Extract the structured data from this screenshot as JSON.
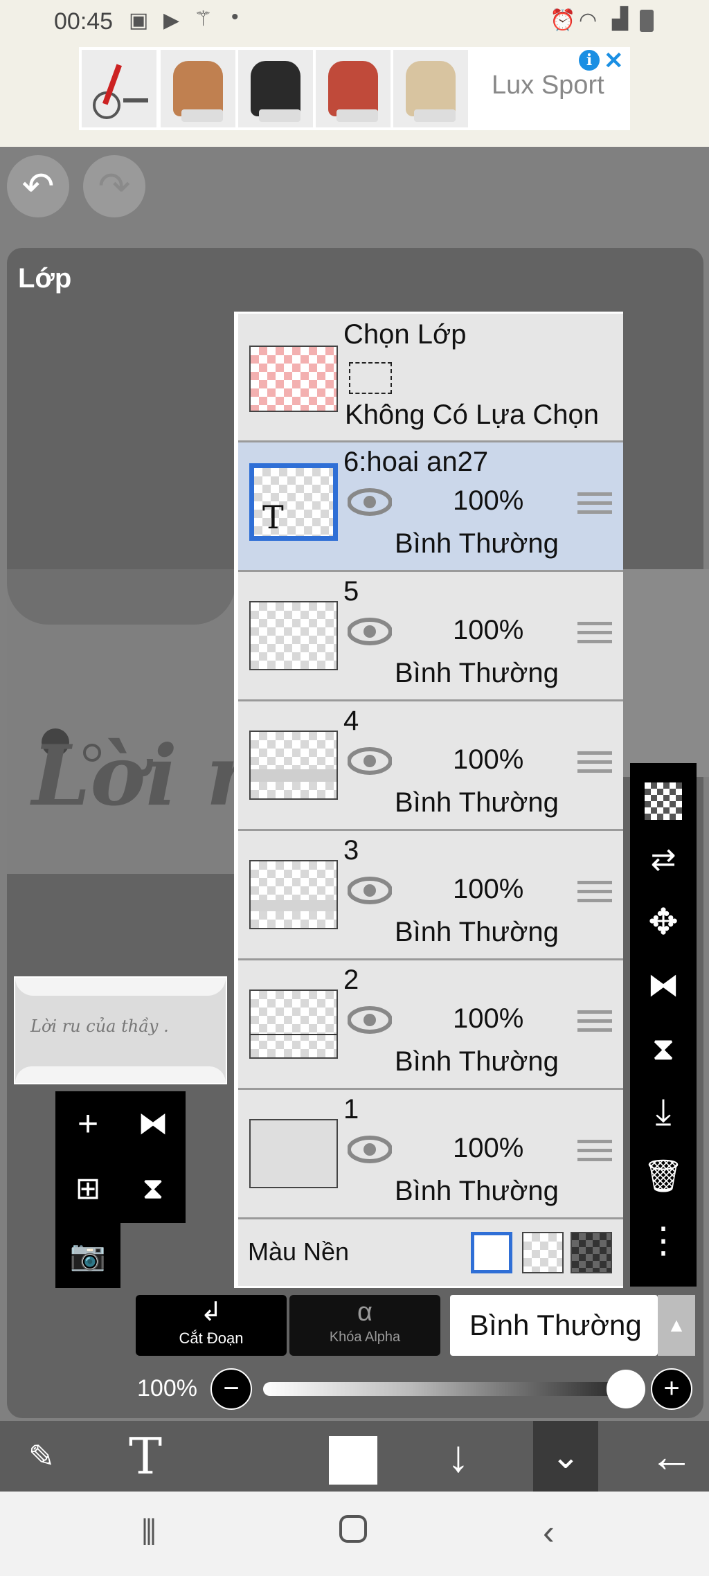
{
  "status_bar": {
    "time": "00:45"
  },
  "ad": {
    "brand": "Lux Sport",
    "info_icon": "i",
    "close_icon": "✕"
  },
  "panel": {
    "title": "Lớp"
  },
  "canvas": {
    "visible_text": "Lời r",
    "preview_text": "Lời ru của thầy ."
  },
  "select_layer": {
    "title": "Chọn Lớp",
    "subtitle": "Không Có Lựa Chọn"
  },
  "layers": [
    {
      "name": "6:hoai an27",
      "opacity": "100%",
      "mode": "Bình Thường",
      "selected": true,
      "thumb_glyph": "T"
    },
    {
      "name": "5",
      "opacity": "100%",
      "mode": "Bình Thường",
      "selected": false
    },
    {
      "name": "4",
      "opacity": "100%",
      "mode": "Bình Thường",
      "selected": false
    },
    {
      "name": "3",
      "opacity": "100%",
      "mode": "Bình Thường",
      "selected": false
    },
    {
      "name": "2",
      "opacity": "100%",
      "mode": "Bình Thường",
      "selected": false
    },
    {
      "name": "1",
      "opacity": "100%",
      "mode": "Bình Thường",
      "selected": false
    }
  ],
  "background": {
    "label": "Màu Nền"
  },
  "bottom_controls": {
    "clip_label": "Cắt Đoạn",
    "alpha_lock_label": "Khóa Alpha",
    "alpha_glyph": "α",
    "blend_mode": "Bình Thường",
    "opacity": "100%"
  },
  "icons": {
    "undo": "↶",
    "redo": "↷",
    "add": "+",
    "move": "✥",
    "trash": "🗑",
    "more": "⋮",
    "camera": "📷",
    "text_tool": "T",
    "down_arrow": "↓",
    "back_arrow": "←",
    "chevron_double": "⌄"
  },
  "colors": {
    "selected_row": "#cbd7ea",
    "selection_border": "#2f6fd6",
    "ad_accent": "#1a8fe3"
  }
}
